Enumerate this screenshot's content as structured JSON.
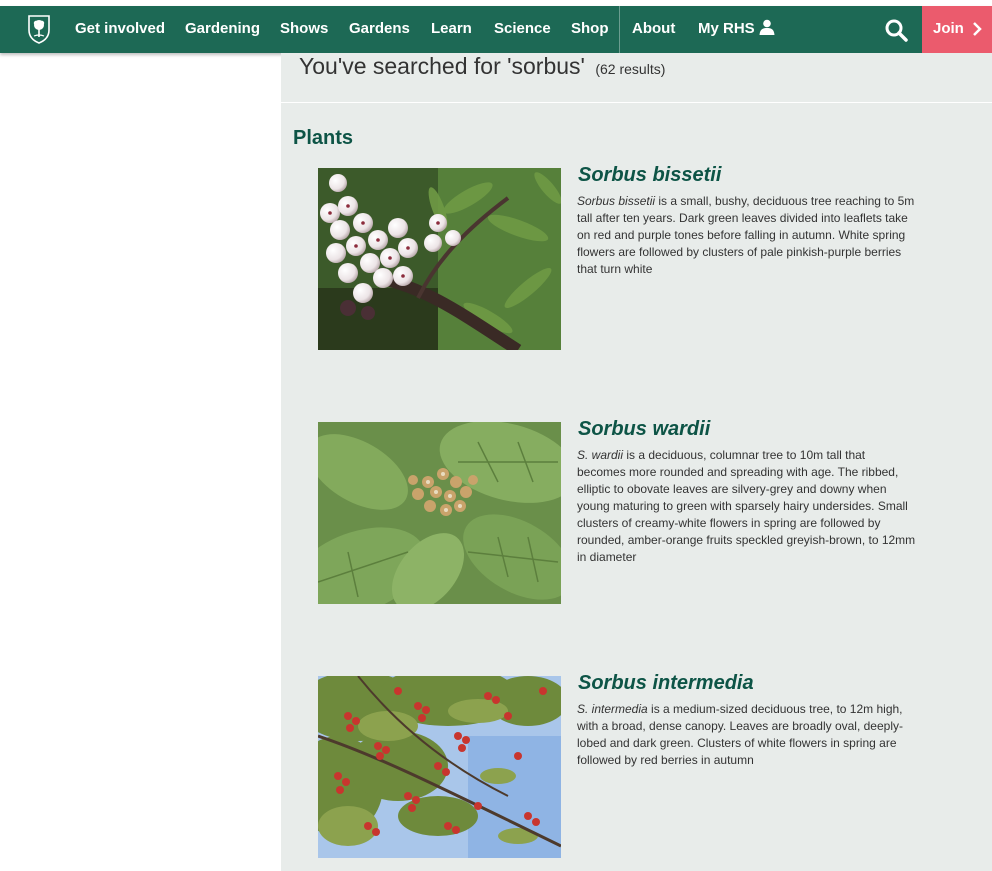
{
  "nav": {
    "items": [
      {
        "label": "Get involved"
      },
      {
        "label": "Gardening"
      },
      {
        "label": "Shows"
      },
      {
        "label": "Gardens"
      },
      {
        "label": "Learn"
      },
      {
        "label": "Science"
      },
      {
        "label": "Shop"
      },
      {
        "label": "About"
      },
      {
        "label": "My RHS"
      }
    ],
    "join_label": "Join",
    "brand_color": "#1d6955",
    "join_color": "#eb5b6d"
  },
  "search": {
    "heading": "You've searched for 'sorbus'",
    "count": "(62 results)"
  },
  "section": {
    "title": "Plants"
  },
  "results": [
    {
      "title": "Sorbus bissetii",
      "desc_name": "Sorbus bissetii",
      "desc_rest": " is a small, bushy, deciduous tree reaching to 5m tall after ten years. Dark green leaves divided into leaflets take on red and purple tones before falling in autumn. White spring flowers are followed by clusters of pale pinkish-purple berries that turn white",
      "image": "white-berries-photo"
    },
    {
      "title": "Sorbus wardii",
      "desc_name": "S. wardii",
      "desc_rest": " is a deciduous, columnar tree to 10m tall that becomes more rounded and spreading with age. The ribbed, elliptic to obovate leaves are silvery-grey and downy when young maturing to green with sparsely hairy undersides. Small clusters of creamy-white flowers in spring are followed by rounded, amber-orange fruits speckled greyish-brown, to 12mm in diameter",
      "image": "green-leaves-photo"
    },
    {
      "title": "Sorbus intermedia",
      "desc_name": "S. intermedia",
      "desc_rest": " is a medium-sized deciduous tree, to 12m high, with a broad, dense canopy. Leaves are broadly oval, deeply-lobed and dark green. Clusters of white flowers in spring are followed by red berries in autumn",
      "image": "red-berries-photo"
    }
  ]
}
